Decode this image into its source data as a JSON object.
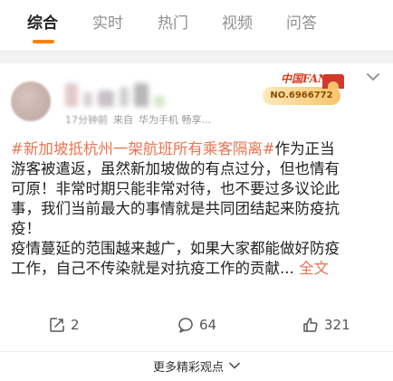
{
  "tabs": [
    {
      "label": "综合",
      "active": true
    },
    {
      "label": "实时",
      "active": false
    },
    {
      "label": "热门",
      "active": false
    },
    {
      "label": "视频",
      "active": false
    },
    {
      "label": "问答",
      "active": false
    }
  ],
  "accent_color": "#ff8200",
  "link_color": "#eb7350",
  "post": {
    "time": "17分钟前",
    "source_prefix": "来自",
    "source": "华为手机 畅享...",
    "fans_badge": {
      "title": "中国FANS",
      "number": "NO.6966772"
    },
    "hashtag": "#新加坡抵杭州一架航班所有乘客隔离#",
    "lines": {
      "l1": "作为正当",
      "l2": "游客被遣返，虽然新加坡做的有点过分，但也情有",
      "l3": "可原！非常时期只能非常对待，也不要过多议论此",
      "l4": "事，我们当前最大的事情就是共同团结起来防疫抗",
      "l5": "疫！",
      "l6": "疫情蔓延的范围越来越广，如果大家都能做好防疫",
      "l7": "工作，自己不传染就是对抗疫工作的贡献...",
      "more": "全文"
    }
  },
  "actions": {
    "repost_count": "2",
    "comment_count": "64",
    "like_count": "321"
  },
  "more_views_label": "更多精彩观点",
  "icons": {
    "repost": "repost-icon",
    "comment": "comment-icon",
    "like": "like-icon",
    "menu": "chevron-down-icon",
    "expand": "chevron-down-icon"
  }
}
